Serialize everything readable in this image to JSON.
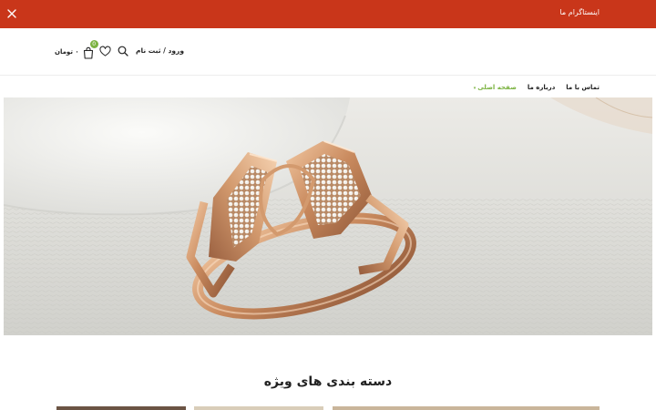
{
  "topbar": {
    "promo_text": "اینستاگرام ما",
    "background": "#c9361a"
  },
  "header": {
    "login_label": "ورود / ثبت نام",
    "cart_price": "۰ تومان",
    "cart_count": "0",
    "icons": [
      "cart-icon",
      "heart-icon",
      "search-icon",
      "close-icon"
    ]
  },
  "nav": {
    "items": [
      "صفحه اصلی",
      "درباره ما",
      "تماس با ما"
    ],
    "active_index": 0,
    "accent": "#7cb342"
  },
  "hero": {
    "subject": "rose-gold-chain-ring"
  },
  "section": {
    "title": "دسته بندی های ویژه"
  }
}
